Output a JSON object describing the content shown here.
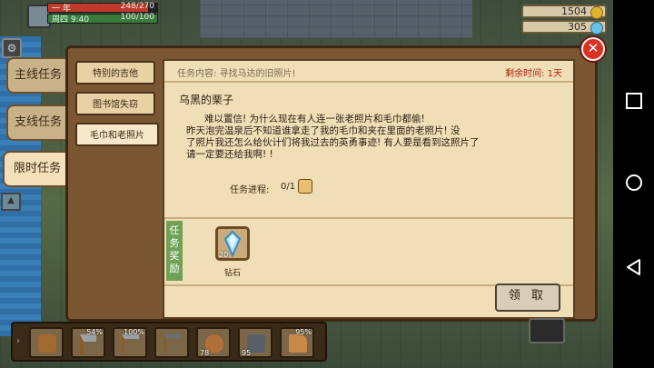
{
  "hud": {
    "player_name": "周四 9:40",
    "hp_text": "248/270",
    "energy_text": "100/100",
    "hp_fraction": 0.92,
    "energy_fraction": 1.0,
    "day_label": "一 年"
  },
  "currency": [
    {
      "value": "1504",
      "icon": "gold-coin-icon",
      "color": "#e0b030"
    },
    {
      "value": "305",
      "icon": "gem-icon",
      "color": "#6cc0e8"
    }
  ],
  "side_tabs": [
    {
      "label": "主线任务",
      "active": false
    },
    {
      "label": "支线任务",
      "active": false
    },
    {
      "label": "限时任务",
      "active": true
    }
  ],
  "quest_list": [
    {
      "label": "特别的吉他",
      "active": false
    },
    {
      "label": "图书馆失窃",
      "active": false
    },
    {
      "label": "毛巾和老照片",
      "active": true
    }
  ],
  "quest_detail": {
    "content_label": "任务内容:  寻找马达的旧照片!",
    "remaining_time": "剩余时间: 1天",
    "giver": "乌黑的栗子",
    "body_lines": [
      "难以置信!  为什么现在有人连一张老照片和毛巾都偷!",
      "昨天泡完温泉后不知道谁拿走了我的毛巾和夹在里面的老照片!  没",
      "了照片我还怎么给伙计们将我过去的英勇事迹!  有人要是看到这照片了",
      "请一定要还给我啊!  !"
    ],
    "progress_label": "任务进程:",
    "progress_value": "0/1"
  },
  "reward": {
    "section_label": "任务奖励",
    "item_name": "钻石",
    "item_count": "20",
    "item_icon": "diamond-icon"
  },
  "claim_label": "领 取",
  "close_icon": "close-icon",
  "hotbar": [
    {
      "icon": "backpack-icon",
      "pct": ""
    },
    {
      "icon": "axe-icon",
      "pct": "54%"
    },
    {
      "icon": "pickaxe-icon",
      "pct": "100%"
    },
    {
      "icon": "hoe-icon",
      "pct": ""
    },
    {
      "icon": "seed-bag-icon",
      "pct": "78"
    },
    {
      "icon": "ore-icon",
      "pct": "95"
    },
    {
      "icon": "watering-can-icon",
      "pct": "95%"
    }
  ],
  "colors": {
    "panel_wood": "#7a5632",
    "parchment": "#f0deb6",
    "timer_red": "#b02010",
    "reward_green": "#6fa257",
    "close_red": "#d83224"
  }
}
